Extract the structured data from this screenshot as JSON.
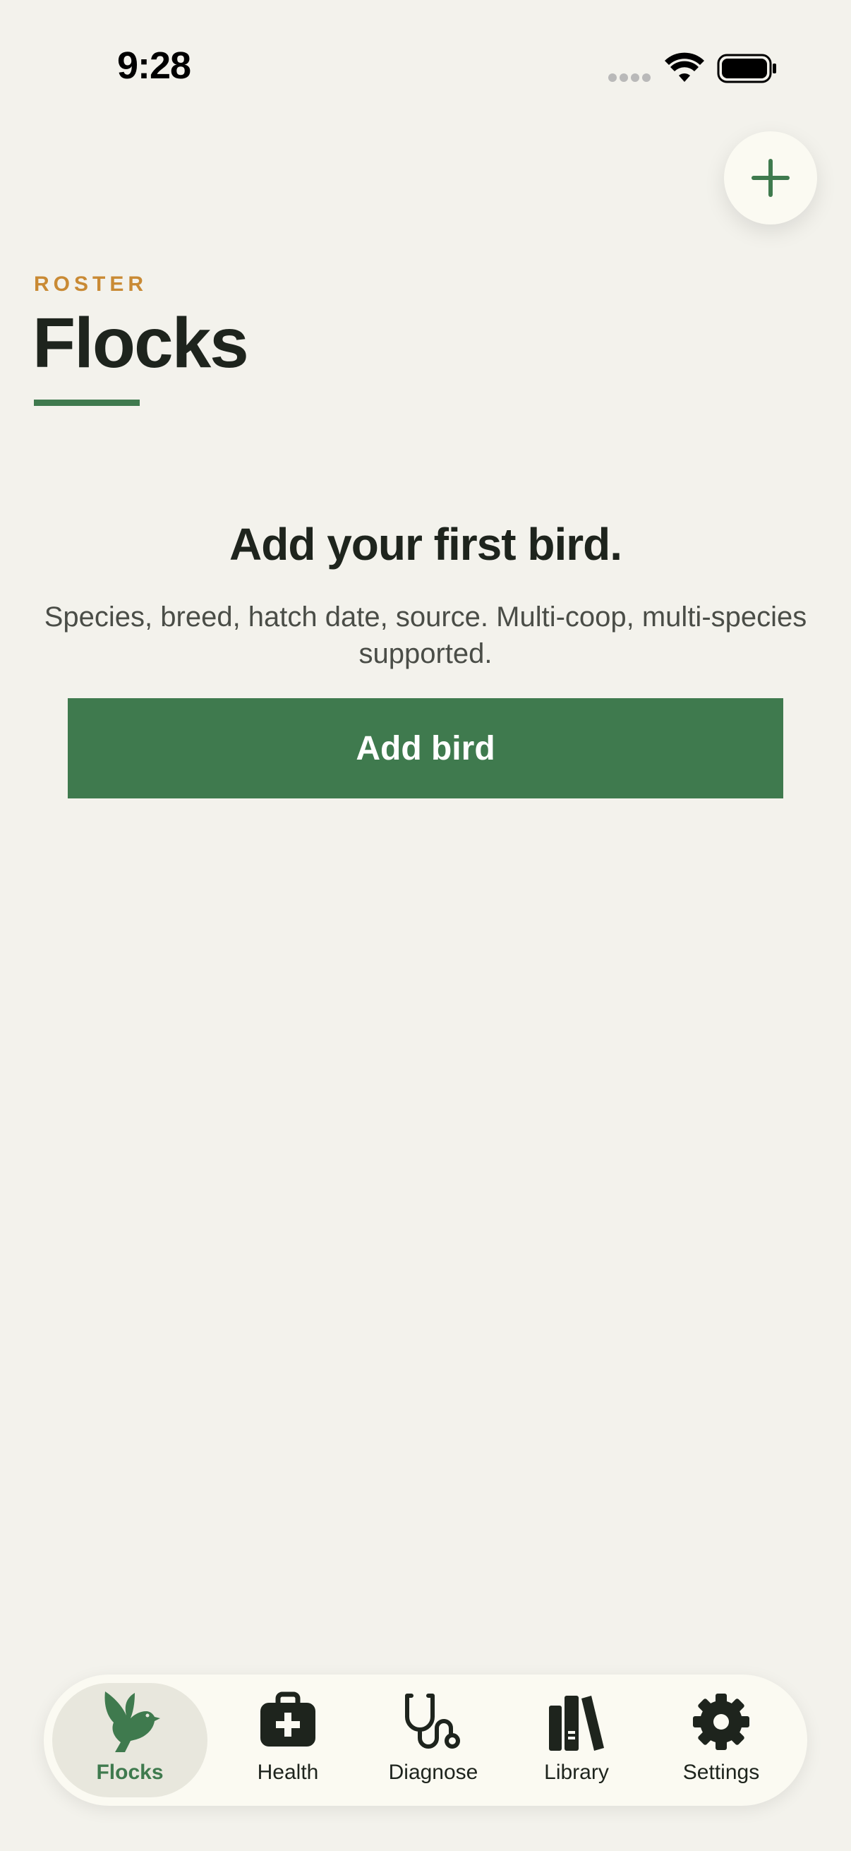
{
  "status": {
    "time": "9:28"
  },
  "roster": {
    "eyebrow": "ROSTER",
    "title": "Flocks"
  },
  "empty_state": {
    "heading": "Add your first bird.",
    "description": "Species, breed, hatch date, source. Multi-coop, multi-species supported.",
    "button_label": "Add bird"
  },
  "tabs": [
    {
      "label": "Flocks",
      "icon": "bird-icon",
      "active": true
    },
    {
      "label": "Health",
      "icon": "medical-kit-icon",
      "active": false
    },
    {
      "label": "Diagnose",
      "icon": "stethoscope-icon",
      "active": false
    },
    {
      "label": "Library",
      "icon": "books-icon",
      "active": false
    },
    {
      "label": "Settings",
      "icon": "gear-icon",
      "active": false
    }
  ],
  "colors": {
    "accent": "#3f7a4e",
    "eyebrow": "#c98a34",
    "background": "#f3f2ec",
    "surface": "#fbfaf2"
  }
}
